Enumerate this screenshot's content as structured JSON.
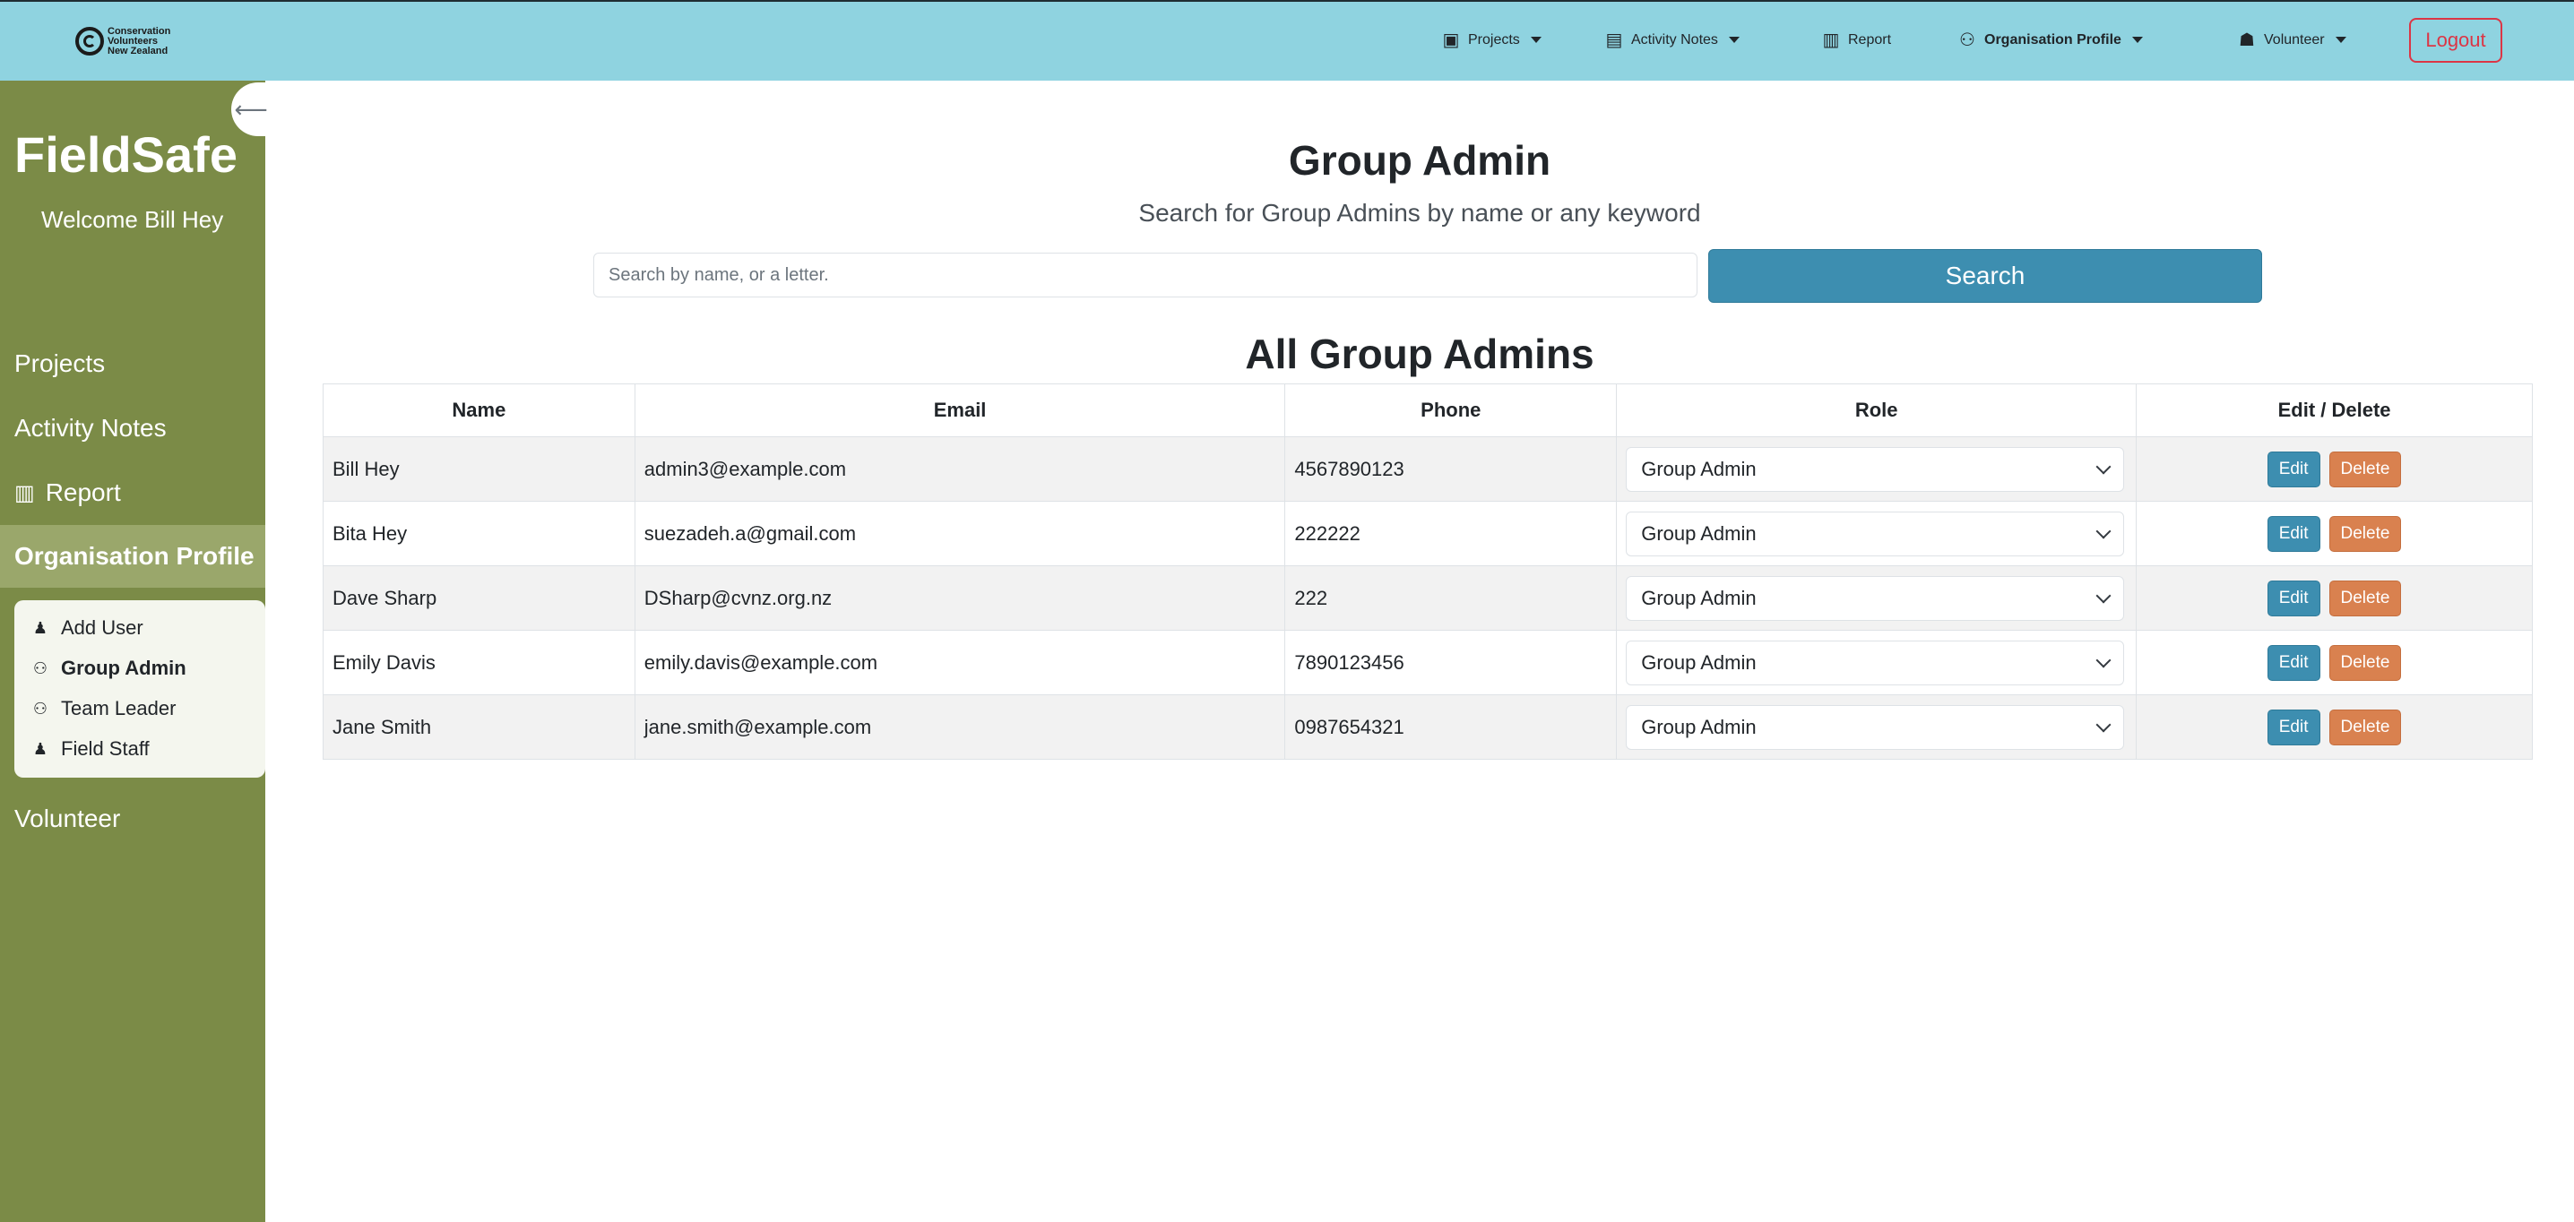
{
  "logo": {
    "lines": [
      "Conservation",
      "Volunteers",
      "New Zealand"
    ]
  },
  "nav": {
    "projects": "Projects",
    "activity_notes": "Activity Notes",
    "report": "Report",
    "organisation_profile": "Organisation Profile",
    "volunteer": "Volunteer",
    "logout": "Logout"
  },
  "sidebar": {
    "collapse_glyph": "⟵",
    "brand": "FieldSafe",
    "welcome": "Welcome Bill Hey",
    "items": [
      "Projects",
      "Activity Notes",
      "Report",
      "Organisation Profile",
      "Volunteer"
    ],
    "submenu": [
      "Add User",
      "Group Admin",
      "Team Leader",
      "Field Staff"
    ]
  },
  "main": {
    "title": "Group Admin",
    "subtitle": "Search for Group Admins by name or any keyword",
    "search_placeholder": "Search by name, or a letter.",
    "search_button": "Search",
    "table_title": "All Group Admins"
  },
  "table": {
    "headers": [
      "Name",
      "Email",
      "Phone",
      "Role",
      "Edit / Delete"
    ],
    "rows": [
      {
        "name": "Bill Hey",
        "email": "admin3@example.com",
        "phone": "4567890123",
        "role": "Group Admin"
      },
      {
        "name": "Bita Hey",
        "email": "suezadeh.a@gmail.com",
        "phone": "222222",
        "role": "Group Admin"
      },
      {
        "name": "Dave Sharp",
        "email": "DSharp@cvnz.org.nz",
        "phone": "222",
        "role": "Group Admin"
      },
      {
        "name": "Emily Davis",
        "email": "emily.davis@example.com",
        "phone": "7890123456",
        "role": "Group Admin"
      },
      {
        "name": "Jane Smith",
        "email": "jane.smith@example.com",
        "phone": "0987654321",
        "role": "Group Admin"
      }
    ],
    "edit_label": "Edit",
    "delete_label": "Delete"
  },
  "colors": {
    "topbar": "#8fd3e0",
    "sidebar": "#7b8b47",
    "primary": "#3d8eb0",
    "danger_outline": "#dc3545",
    "delete": "#d9814f"
  }
}
